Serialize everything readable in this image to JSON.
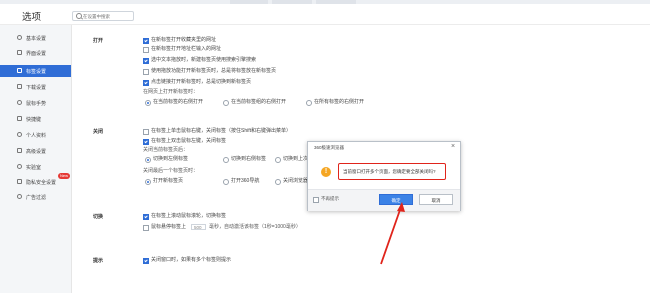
{
  "window": {
    "title": "选项",
    "search_placeholder": "在设置中搜索"
  },
  "sidebar": {
    "items": [
      {
        "label": "基本设置",
        "icon": "gear-icon"
      },
      {
        "label": "界面设置",
        "icon": "window-icon"
      },
      {
        "label": "标签设置",
        "icon": "tab-icon",
        "active": true
      },
      {
        "label": "下载设置",
        "icon": "download-icon"
      },
      {
        "label": "鼠标手势",
        "icon": "mouse-icon"
      },
      {
        "label": "快捷键",
        "icon": "keyboard-icon"
      },
      {
        "label": "个人资料",
        "icon": "user-icon"
      },
      {
        "label": "高级设置",
        "icon": "advanced-icon"
      },
      {
        "label": "实验室",
        "icon": "lab-icon"
      },
      {
        "label": "隐私安全设置",
        "icon": "shield-icon",
        "badge": "New"
      },
      {
        "label": "广告过滤",
        "icon": "block-icon"
      }
    ]
  },
  "sections": {
    "open": {
      "title": "打开",
      "options": [
        {
          "label": "在新标签打开收藏夹里的网址",
          "checked": true
        },
        {
          "label": "在新标签打开地址栏输入的网址",
          "checked": false
        },
        {
          "label": "选中文本拖放时，新建标签页使用搜索引擎搜索",
          "checked": true
        },
        {
          "label": "使用拖放功能打开新标签页时，总是将标签放在新标签页",
          "checked": false
        },
        {
          "label": "点击链接打开新标签时，总是切换到新标签页",
          "checked": true
        }
      ],
      "position_label": "在网页上打开新标签时：",
      "position_options": [
        {
          "label": "在当前标签的右侧打开",
          "selected": true
        },
        {
          "label": "在当前标签组的右侧打开",
          "selected": false
        },
        {
          "label": "在所有标签的右侧打开",
          "selected": false
        }
      ]
    },
    "close": {
      "title": "关闭",
      "options": [
        {
          "label": "在标签上单击鼠标右键，关闭标签（按住Shift和右键弹出菜单）",
          "checked": false
        },
        {
          "label": "在标签上双击鼠标左键，关闭标签",
          "checked": true
        }
      ],
      "after_close_label": "关闭当前标签页后：",
      "after_close_options": [
        {
          "label": "切换到左侧标签",
          "selected": true
        },
        {
          "label": "切换到右侧标签",
          "selected": false
        },
        {
          "label": "切换到上次访问标签",
          "selected": false
        }
      ],
      "last_tab_label": "关闭最后一个标签页时：",
      "last_tab_options": [
        {
          "label": "打开新标签页",
          "selected": true
        },
        {
          "label": "打开360导航",
          "selected": false
        },
        {
          "label": "关闭浏览器",
          "selected": false
        }
      ]
    },
    "switch": {
      "title": "切换",
      "options": [
        {
          "label": "在标签上滚动鼠标滚轮，切换标签",
          "checked": true
        }
      ],
      "hover_prefix": "鼠标悬停标签上",
      "hover_value": "500",
      "hover_suffix": "毫秒，自动激活该标签（1秒=1000毫秒）"
    },
    "prompt": {
      "title": "提示",
      "options": [
        {
          "label": "关闭窗口时，如果有多个标签则提示",
          "checked": true
        }
      ]
    }
  },
  "dialog": {
    "title": "360极速浏览器",
    "close_glyph": "×",
    "warning_glyph": "!",
    "message": "当前窗口打开多个页面，您确定要全部关闭吗?",
    "dont_show_label": "不再提示",
    "ok_label": "确定",
    "cancel_label": "取消"
  },
  "colors": {
    "accent": "#2f6dd6",
    "highlight": "#e0241b",
    "warning": "#f5a623",
    "new_badge": "#e53935"
  }
}
